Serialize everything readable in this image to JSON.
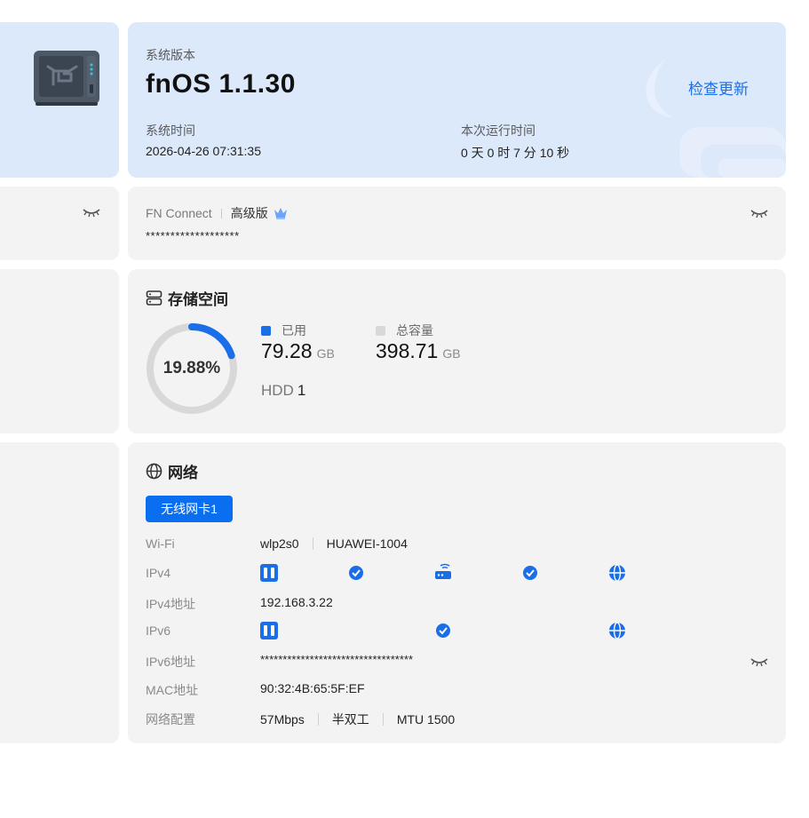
{
  "system": {
    "version_label": "系统版本",
    "version": "fnOS  1.1.30",
    "update_button": "检查更新",
    "time_label": "系统时间",
    "time_value": "2026-04-26 07:31:35",
    "uptime_label": "本次运行时间",
    "uptime_value": "0 天 0 时 7 分 10 秒"
  },
  "connect": {
    "name": "FN Connect",
    "tier": "高级版",
    "masked_value": "*******************"
  },
  "storage": {
    "title": "存储空间",
    "usage_percent": "19.88%",
    "usage_fraction": 0.1988,
    "used_label": "已用",
    "used_value": "79.28",
    "used_unit": "GB",
    "total_label": "总容量",
    "total_value": "398.71",
    "total_unit": "GB",
    "disk_type": "HDD",
    "disk_count": "1",
    "colors": {
      "used": "#1a6fe8",
      "total": "#d8d8d8"
    }
  },
  "network": {
    "title": "网络",
    "nic_tab": "无线网卡1",
    "rows": {
      "wifi_label": "Wi-Fi",
      "wifi_iface": "wlp2s0",
      "wifi_ssid": "HUAWEI-1004",
      "ipv4_label": "IPv4",
      "ipv4_addr_label": "IPv4地址",
      "ipv4_addr": "192.168.3.22",
      "ipv6_label": "IPv6",
      "ipv6_addr_label": "IPv6地址",
      "ipv6_addr": "**********************************",
      "mac_label": "MAC地址",
      "mac": "90:32:4B:65:5F:EF",
      "config_label": "网络配置",
      "speed": "57Mbps",
      "duplex": "半双工",
      "mtu": "MTU 1500"
    },
    "icons": [
      "nic-icon",
      "check-icon",
      "router-icon",
      "globe-icon",
      "eye-closed-icon"
    ]
  },
  "colors": {
    "accent": "#1a6fe8",
    "card_bg": "#f3f3f3",
    "system_bg": "#dce9fb"
  }
}
